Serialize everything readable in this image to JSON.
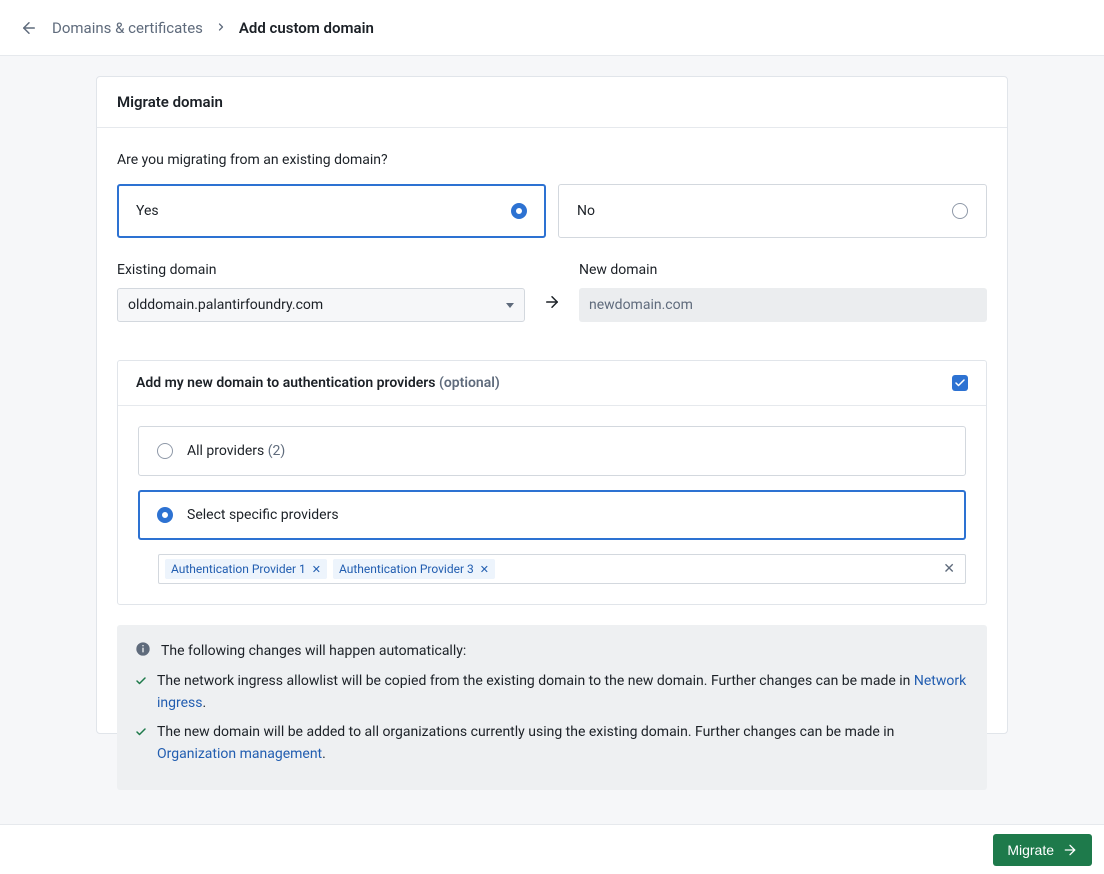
{
  "breadcrumb": {
    "parent": "Domains & certificates",
    "current": "Add custom domain"
  },
  "card": {
    "title": "Migrate domain",
    "question": "Are you migrating from an existing domain?",
    "yes": "Yes",
    "no": "No",
    "existing_label": "Existing domain",
    "new_label": "New domain",
    "existing_value": "olddomain.palantirfoundry.com",
    "new_value": "newdomain.com"
  },
  "auth": {
    "title": "Add my new domain to authentication providers",
    "optional": " (optional)",
    "all_label": "All providers ",
    "all_count": "(2)",
    "specific_label": "Select specific providers",
    "tags": [
      "Authentication Provider 1",
      "Authentication Provider 3"
    ]
  },
  "info": {
    "heading": "The following changes will happen automatically:",
    "row1_a": "The network ingress allowlist will be copied from the existing domain to the new domain. Further changes can be made in ",
    "row1_link": "Network ingress",
    "row1_b": ".",
    "row2_a": "The new domain will be added to all organizations currently using the existing domain. Further changes can be made in ",
    "row2_link": "Organization management",
    "row2_b": "."
  },
  "footer": {
    "submit": "Migrate"
  }
}
